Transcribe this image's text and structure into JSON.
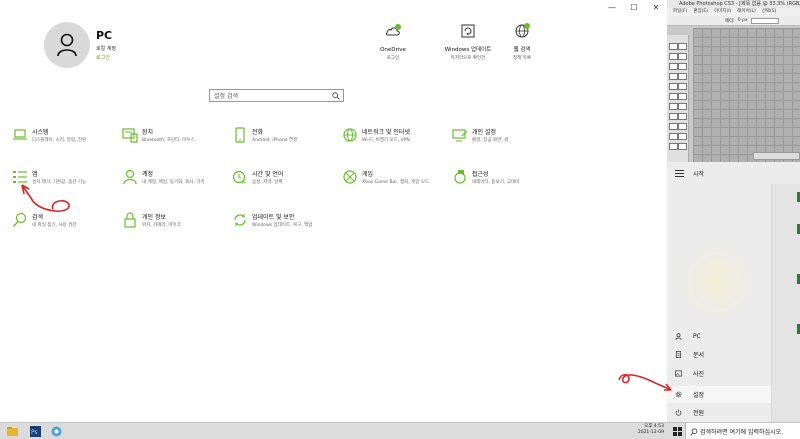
{
  "window": {
    "minimize": "—",
    "maximize": "☐",
    "close": "✕"
  },
  "profile": {
    "name": "PC",
    "type": "로컬 계정",
    "action": "로그인"
  },
  "quick": [
    {
      "label": "OneDrive",
      "sub": "로그인",
      "icon": "onedrive-icon"
    },
    {
      "label": "Windows 업데이트",
      "sub": "마지막으로 확인한",
      "icon": "windows-update-icon"
    },
    {
      "label": "웹 검색",
      "sub": "정책 목록",
      "icon": "globe-icon"
    }
  ],
  "search": {
    "placeholder": "설정 검색"
  },
  "tiles": [
    {
      "title": "시스템",
      "desc": "디스플레이, 소리, 알림, 전원",
      "icon": "laptop-icon"
    },
    {
      "title": "장치",
      "desc": "Bluetooth, 프린터, 마우스",
      "icon": "keyboard-icon"
    },
    {
      "title": "전화",
      "desc": "Android, iPhone 연결",
      "icon": "phone-icon"
    },
    {
      "title": "네트워크 및 인터넷",
      "desc": "Wi-Fi, 비행기 모드, VPN",
      "icon": "globe-icon"
    },
    {
      "title": "개인 설정",
      "desc": "배경, 잠금 화면, 색",
      "icon": "personalization-icon"
    },
    {
      "title": "앱",
      "desc": "설치 제거, 기본값, 옵션 기능",
      "icon": "apps-list-icon"
    },
    {
      "title": "계정",
      "desc": "내 계정, 메일, 동기화, 회사, 가족",
      "icon": "person-icon"
    },
    {
      "title": "시간 및 언어",
      "desc": "음성, 지역, 날짜",
      "icon": "time-language-icon"
    },
    {
      "title": "게임",
      "desc": "Xbox Game Bar, 캡처, 게임 모드",
      "icon": "xbox-icon"
    },
    {
      "title": "접근성",
      "desc": "내레이터, 돋보기, 고대비",
      "icon": "accessibility-icon"
    },
    {
      "title": "검색",
      "desc": "내 파일 찾기, 사용 권한",
      "icon": "search-icon"
    },
    {
      "title": "개인 정보",
      "desc": "위치, 카메라, 마이크",
      "icon": "lock-icon"
    },
    {
      "title": "업데이트 및 보안",
      "desc": "Windows 업데이트, 복구, 백업",
      "icon": "update-icon"
    }
  ],
  "photoshop": {
    "title": "Adobe Photoshop CS3 - [제목 없음 @ 33.3% (RGB/8)]",
    "menu": [
      "파일(F)",
      "편집(E)",
      "이미지(I)",
      "레이어(L)",
      "선택(S)"
    ],
    "option_label": "페더:",
    "option_value": "0 px"
  },
  "start_menu": {
    "title": "시작",
    "items": [
      {
        "label": "PC",
        "icon": "user-icon"
      },
      {
        "label": "문서",
        "icon": "document-icon"
      },
      {
        "label": "사진",
        "icon": "pictures-icon"
      },
      {
        "label": "설정",
        "icon": "gear-icon"
      },
      {
        "label": "전원",
        "icon": "power-icon"
      }
    ]
  },
  "taskbar": {
    "time": "오후 4:53",
    "date": "2021-12-09",
    "search_text": "검색하려면 여기에 입력하십시오."
  },
  "colors": {
    "accent": "#6cbb2b",
    "annotation": "#d6262b"
  }
}
